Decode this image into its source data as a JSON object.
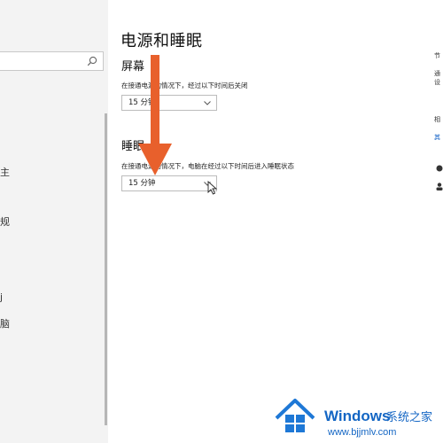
{
  "page_title": "电源和睡眠",
  "screen": {
    "title": "屏幕",
    "description": "在接通电源的情况下，经过以下时间后关闭",
    "selected": "15 分钟"
  },
  "sleep": {
    "title": "睡眠",
    "description": "在接通电源的情况下，电脑在经过以下时间后进入睡眠状态",
    "selected": "15 分钟"
  },
  "nav": {
    "glyphs": [
      "主",
      "规",
      "j",
      "脑"
    ]
  },
  "right_col": {
    "glyphs": [
      "节",
      "通",
      "设",
      "相",
      "其"
    ]
  },
  "watermark": {
    "brand": "Windows",
    "site_name": "系统之家",
    "url": "www.bjjmlv.com"
  },
  "colors": {
    "arrow": "#e8602c",
    "watermark": "#1466c4"
  }
}
